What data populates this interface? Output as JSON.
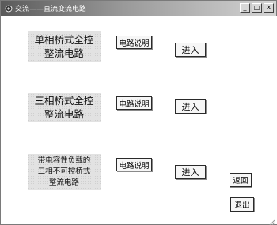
{
  "window": {
    "title": "交流——直流变流电路",
    "minimize_glyph": "_",
    "maximize_glyph": "□",
    "close_glyph": "✕",
    "titlebar_color": "#5a5a5a",
    "panel_color": "#e2e2e2"
  },
  "circuits": [
    {
      "lines": [
        "单相桥式全控",
        "整流电路"
      ],
      "desc_label": "电路说明",
      "enter_label": "进入"
    },
    {
      "lines": [
        "三相桥式全控",
        "整流电路"
      ],
      "desc_label": "电路说明",
      "enter_label": "进入"
    },
    {
      "lines": [
        "带电容性负载的",
        "三相不可控桥式",
        "整流电路"
      ],
      "desc_label": "电路说明",
      "enter_label": "进入"
    }
  ],
  "footer": {
    "back_label": "返回",
    "exit_label": "退出"
  }
}
